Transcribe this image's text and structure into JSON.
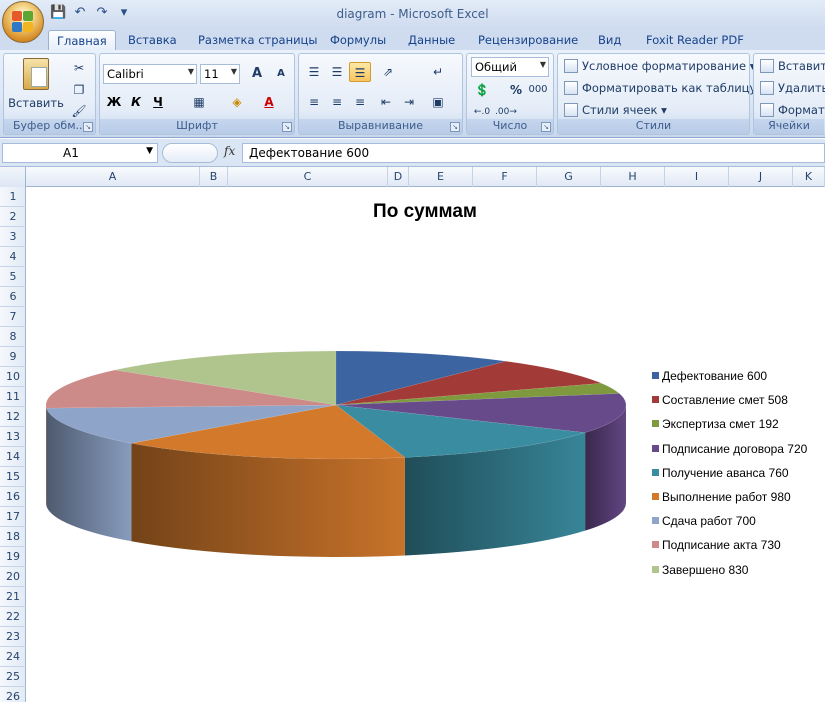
{
  "window": {
    "title": "diagram - Microsoft Excel"
  },
  "ribbon": {
    "tabs": [
      "Главная",
      "Вставка",
      "Разметка страницы",
      "Формулы",
      "Данные",
      "Рецензирование",
      "Вид",
      "Foxit Reader PDF"
    ],
    "active_tab": "Главная",
    "clipboard": {
      "paste_label": "Вставить",
      "group_label": "Буфер обм..."
    },
    "font": {
      "name": "Calibri",
      "size": "11",
      "group_label": "Шрифт",
      "bold": "Ж",
      "italic": "К",
      "underline": "Ч",
      "grow": "A",
      "shrink": "A"
    },
    "alignment": {
      "group_label": "Выравнивание"
    },
    "number": {
      "format": "Общий",
      "percent": "%",
      "thousands": "000",
      "group_label": "Число"
    },
    "styles": {
      "conditional": "Условное форматирование",
      "as_table": "Форматировать как таблицу",
      "cell_styles": "Стили ячеек",
      "group_label": "Стили"
    },
    "cells": {
      "insert": "Вставить",
      "delete": "Удалить",
      "format": "Формат",
      "group_label": "Ячейки"
    }
  },
  "formula_bar": {
    "name_box": "A1",
    "fx": "fx",
    "content": "Дефектование 600"
  },
  "columns": [
    "A",
    "B",
    "C",
    "D",
    "E",
    "F",
    "G",
    "H",
    "I",
    "J",
    "K"
  ],
  "rows": [
    "1",
    "2",
    "3",
    "4",
    "5",
    "6",
    "7",
    "8",
    "9",
    "10",
    "11",
    "12",
    "13",
    "14",
    "15",
    "16",
    "17",
    "18",
    "19",
    "20",
    "21",
    "22",
    "23",
    "24",
    "25",
    "26"
  ],
  "colors": {
    "accent": "#15428b",
    "ribbon_bg": "#dbe6f5"
  },
  "chart_data": {
    "type": "pie",
    "title": "По суммам",
    "legend_position": "right",
    "labels": [
      "Дефектование",
      "Составление смет",
      "Экспертиза смет",
      "Подписание договора",
      "Получение аванса",
      "Выполнение работ",
      "Сдача работ",
      "Подписание акта",
      "Завершено"
    ],
    "values": [
      600,
      508,
      192,
      720,
      760,
      980,
      700,
      730,
      830
    ],
    "legend_labels": [
      "Дефектование 600",
      "Составление смет 508",
      "Экспертиза смет 192",
      "Подписание договора 720",
      "Получение аванса 760",
      "Выполнение работ 980",
      "Сдача работ 700",
      "Подписание акта 730",
      "Завершено 830"
    ],
    "colors": [
      "#3b64a0",
      "#a23a37",
      "#7f9a3e",
      "#674a8a",
      "#3a8ca0",
      "#d2792c",
      "#8ea4c8",
      "#cc8a88",
      "#b0c48d"
    ]
  }
}
